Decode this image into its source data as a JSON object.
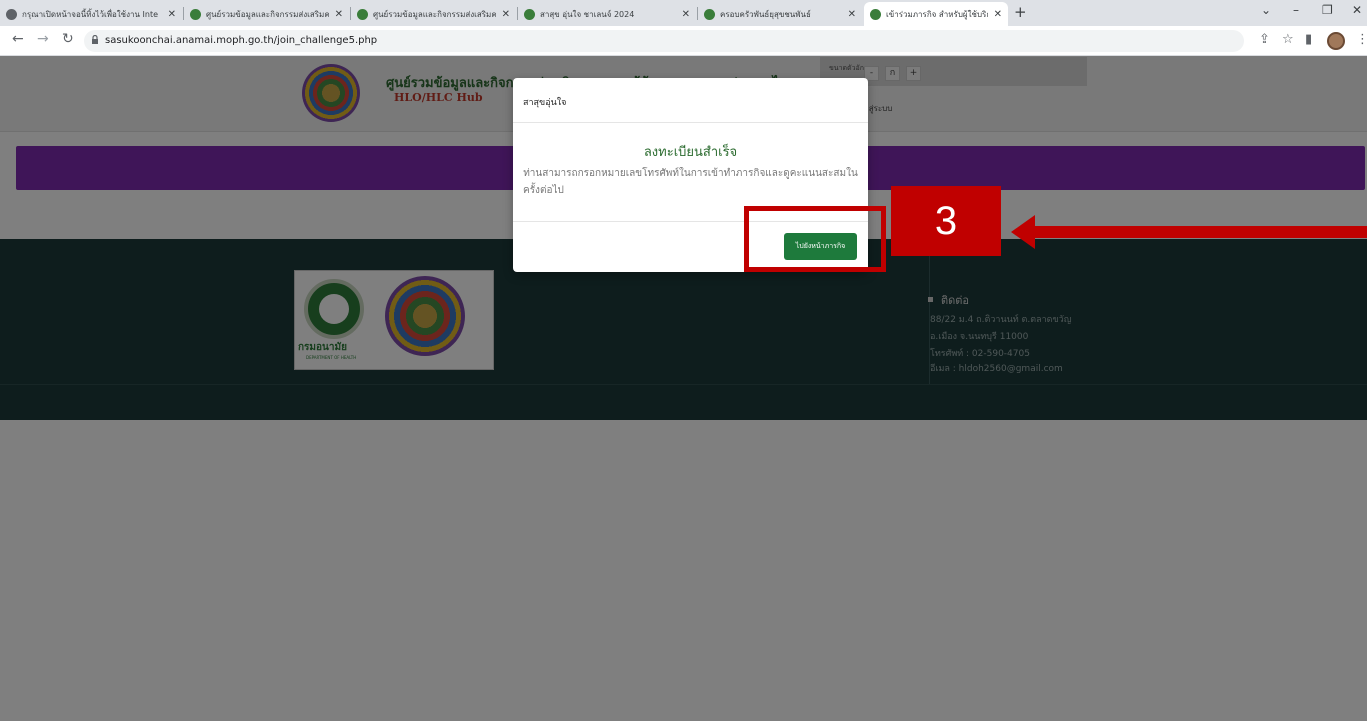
{
  "browser": {
    "tabs": [
      {
        "title": "กรุณาเปิดหน้าจอนี้ทิ้งไว้เพื่อใช้งาน Inte",
        "favicon_color": "#5f6368"
      },
      {
        "title": "ศูนย์รวมข้อมูลและกิจกรรมส่งเสริมความ",
        "favicon_color": "#3a7d3a"
      },
      {
        "title": "ศูนย์รวมข้อมูลและกิจกรรมส่งเสริมความ",
        "favicon_color": "#3a7d3a"
      },
      {
        "title": "สาสุข อุ่นใจ ชาเลนจ์ 2024",
        "favicon_color": "#3a7d3a"
      },
      {
        "title": "ครอบครัวพันธ์ยุสุขชนพันธ์",
        "favicon_color": "#3a7d3a"
      },
      {
        "title": "เข้าร่วมภารกิจ สำหรับผู้ใช้บริการ",
        "favicon_color": "#3a7d3a"
      }
    ],
    "url": "sasukoonchai.anamai.moph.go.th/join_challenge5.php"
  },
  "header": {
    "site_title": "ศูนย์รวมข้อมูลและกิจกรรมส่งเสริมความรอบรู้ด้านสุขภาพของประเทศไทย",
    "site_subtitle": "HLO/HLC Hub",
    "font_size_label": "ขนาดตัวอักษร",
    "font_buttons": [
      "-",
      "ก",
      "+"
    ],
    "login_label": "เข้าสู่ระบบ"
  },
  "footer": {
    "dept_name": "กรมอนามัย",
    "dept_en": "DEPARTMENT OF HEALTH",
    "contact_title": "ติดต่อ",
    "contact_lines": [
      "88/22 ม.4 ถ.ติวานนท์ ต.ตลาดขวัญ",
      "อ.เมือง จ.นนทบุรี 11000",
      "โทรศัพท์ : 02-590-4705",
      "อีเมล : hldoh2560@gmail.com"
    ]
  },
  "modal": {
    "header": "สาสุขอุ่นใจ",
    "title": "ลงทะเบียนสำเร็จ",
    "message_line1": "ท่านสามารถกรอกหมายเลขโทรศัพท์ในการเข้าทำภารกิจและดูคะแนนสะสมใน",
    "message_line2": "ครั้งต่อไป",
    "button_label": "ไปยังหน้าภารกิจ"
  },
  "annotation": {
    "step_number": "3",
    "color": "#c00000"
  },
  "colors": {
    "purple_bar": "#7e2ab1",
    "footer_bg": "#1c3a3a",
    "modal_button": "#1e7a3c"
  }
}
